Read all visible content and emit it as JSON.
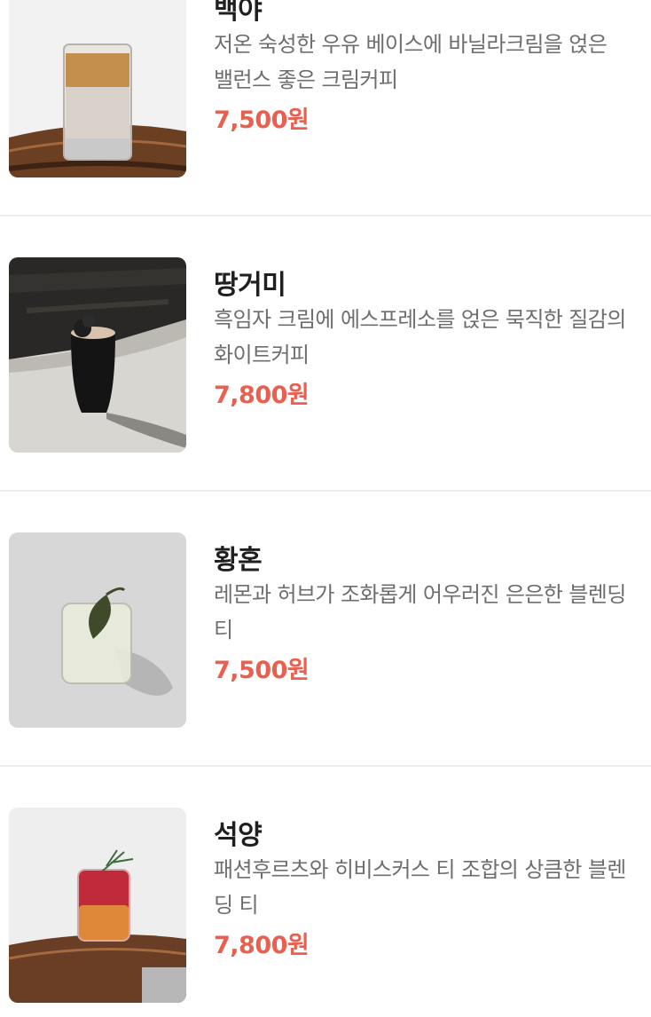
{
  "menu": {
    "items": [
      {
        "name": "백야",
        "description": "저온 숙성한 우유 베이스에 바닐라크림을 얹은 밸런스 좋은 크림커피",
        "price": "7,500원",
        "image": "creamy-coffee-glass-on-wood-table"
      },
      {
        "name": "땅거미",
        "description": "흑임자 크림에 에스프레소를 얹은 묵직한 질감의 화이트커피",
        "price": "7,800원",
        "image": "black-cup-coffee-on-stone"
      },
      {
        "name": "황혼",
        "description": "레몬과 허브가 조화롭게 어우러진 은은한 블렌딩 티",
        "price": "7,500원",
        "image": "lemon-herb-tea-glass-with-leaf"
      },
      {
        "name": "석양",
        "description": "패션후르츠와 히비스커스 티 조합의 상큼한 블렌딩 티",
        "price": "7,800원",
        "image": "red-hibiscus-tea-glass-with-rosemary"
      }
    ]
  }
}
